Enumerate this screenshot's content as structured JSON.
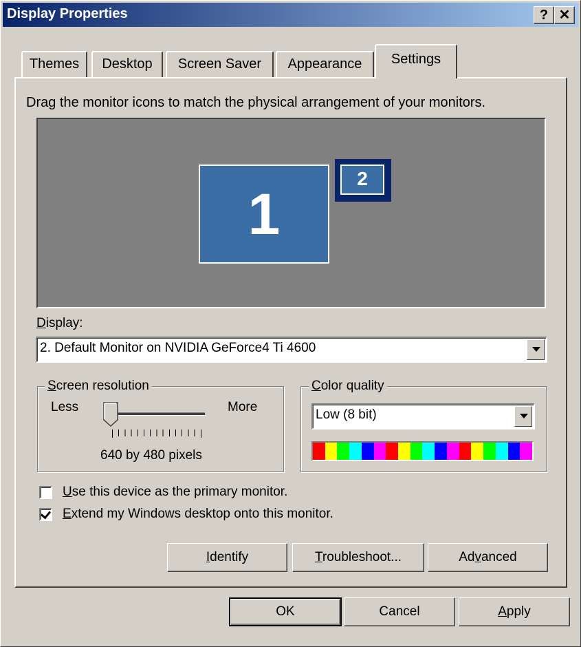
{
  "window": {
    "title": "Display Properties",
    "help_glyph": "?",
    "close_glyph": "✕"
  },
  "tabs": [
    {
      "label": "Themes"
    },
    {
      "label": "Desktop"
    },
    {
      "label": "Screen Saver"
    },
    {
      "label": "Appearance"
    },
    {
      "label": "Settings",
      "active": true
    }
  ],
  "settings": {
    "instruction": "Drag the monitor icons to match the physical arrangement of your monitors.",
    "monitors": [
      {
        "number": "1"
      },
      {
        "number": "2"
      }
    ],
    "display_label_key": "D",
    "display_label_rest": "isplay:",
    "display_value": "2. Default Monitor on NVIDIA GeForce4 Ti 4600",
    "resolution": {
      "title_key": "S",
      "title_rest": "creen resolution",
      "less": "Less",
      "more": "More",
      "value_text": "640 by 480 pixels",
      "slider_position": 0
    },
    "color_quality": {
      "title_key": "C",
      "title_rest": "olor quality",
      "value": "Low (8 bit)"
    },
    "primary_checkbox": {
      "key": "U",
      "rest": "se this device as the primary monitor.",
      "checked": false
    },
    "extend_checkbox": {
      "key": "E",
      "rest": "xtend my Windows desktop onto this monitor.",
      "checked": true
    },
    "buttons": {
      "identify_key": "I",
      "identify_rest": "dentify",
      "troubleshoot_key": "T",
      "troubleshoot_rest": "roubleshoot...",
      "advanced_pre": "Ad",
      "advanced_key": "v",
      "advanced_rest": "anced"
    }
  },
  "footer": {
    "ok": "OK",
    "cancel": "Cancel",
    "apply_key": "A",
    "apply_rest": "pply"
  },
  "colors": {
    "titlebar_start": "#0a246a",
    "titlebar_end": "#a6caf0",
    "monitor_fill": "#3a6ea5",
    "monitor_area": "#808080",
    "color_swatches": [
      "#ff0000",
      "#ffff00",
      "#00ff00",
      "#00ffff",
      "#0000ff",
      "#ff00ff",
      "#ff0000",
      "#ffff00",
      "#00ff00",
      "#00ffff",
      "#0000ff",
      "#ff00ff",
      "#ff0000",
      "#ffff00",
      "#00ff00",
      "#00ffff",
      "#0000ff",
      "#ff00ff"
    ]
  }
}
